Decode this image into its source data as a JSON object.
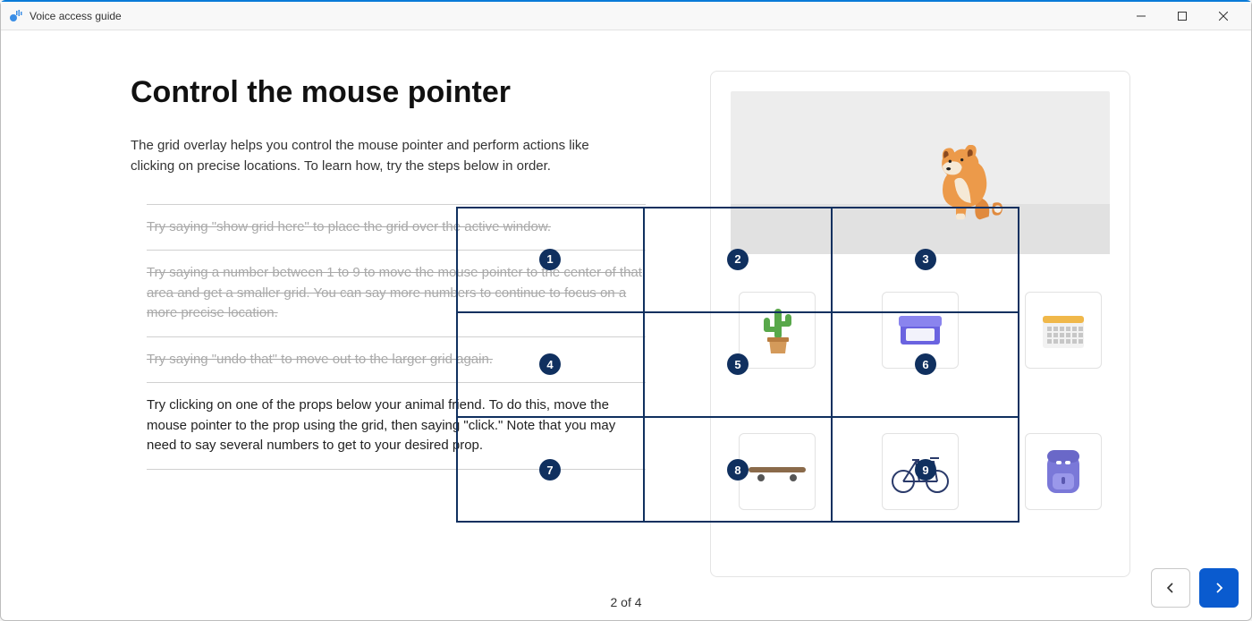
{
  "window": {
    "title": "Voice access guide"
  },
  "page": {
    "heading": "Control the mouse pointer",
    "intro": "The grid overlay helps you control the mouse pointer and perform actions like clicking on precise locations. To learn how, try the steps below in order.",
    "page_indicator": "2 of 4"
  },
  "steps": [
    {
      "text": "Try saying \"show grid here\" to place the grid over the active window.",
      "done": true
    },
    {
      "text": "Try saying a number between 1 to 9 to move the mouse pointer to the center of that area and get a smaller grid. You can say more numbers to continue to focus on a more precise location.",
      "done": true
    },
    {
      "text": "Try saying \"undo that\" to move out to the larger grid again.",
      "done": true
    },
    {
      "text": "Try clicking on one of the props below your animal friend. To do this, move the mouse pointer to the prop using the grid, then saying \"click.\" Note that you may need to say several numbers to get to your desired prop.",
      "done": false
    }
  ],
  "grid": {
    "cells": [
      "1",
      "2",
      "3",
      "4",
      "5",
      "6",
      "7",
      "8",
      "9"
    ]
  },
  "props": [
    {
      "name": "cactus"
    },
    {
      "name": "container"
    },
    {
      "name": "calendar"
    },
    {
      "name": "skateboard"
    },
    {
      "name": "bicycle"
    },
    {
      "name": "backpack"
    }
  ]
}
